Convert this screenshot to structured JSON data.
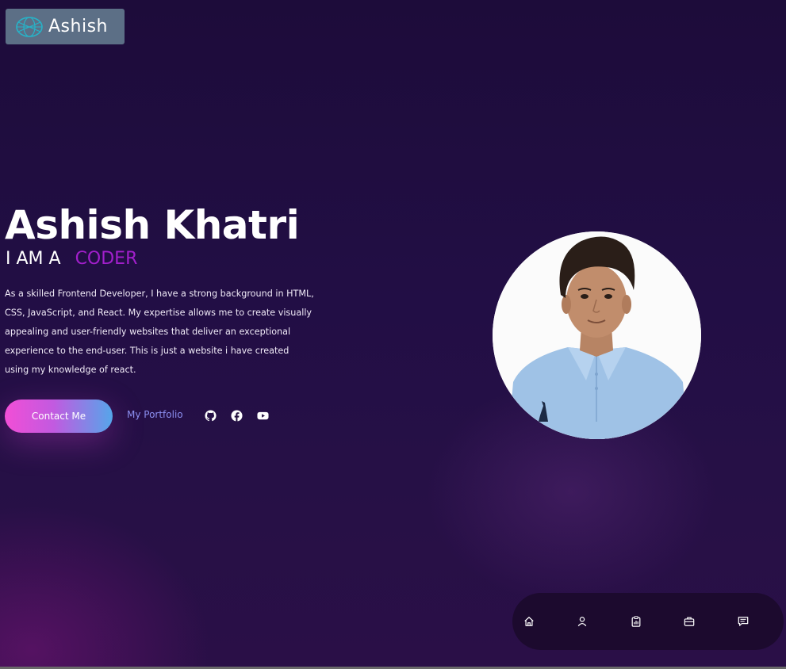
{
  "logo": {
    "text": "Ashish",
    "icon": "globe-network-icon",
    "background": "#5c6f86"
  },
  "hero": {
    "name": "Ashish Khatri",
    "tagline_prefix": "I AM A",
    "tagline_role": "CODER",
    "bio": "As a skilled Frontend Developer, I have a strong background in HTML, CSS, JavaScript, and React. My expertise allows me to create visually appealing and user-friendly websites that deliver an exceptional experience to the end-user. This is just a website i have created using my knowledge of react."
  },
  "actions": {
    "contact_label": "Contact Me",
    "portfolio_label": "My Portfolio",
    "social": [
      {
        "icon": "github-icon"
      },
      {
        "icon": "facebook-icon"
      },
      {
        "icon": "youtube-icon"
      }
    ]
  },
  "profile_photo": {
    "icon": "profile-photo"
  },
  "bottom_nav": {
    "items": [
      {
        "icon": "home-icon"
      },
      {
        "icon": "user-icon"
      },
      {
        "icon": "clipboard-chart-icon"
      },
      {
        "icon": "briefcase-icon"
      },
      {
        "icon": "message-icon"
      }
    ]
  },
  "colors": {
    "background": "#1f0c3d",
    "accent_role": "#a21fcc",
    "portfolio_link": "#8c8ff0",
    "button_gradient_start": "#f24ed6",
    "button_gradient_end": "#55a6ea",
    "nav_background": "#1c0a2e"
  }
}
